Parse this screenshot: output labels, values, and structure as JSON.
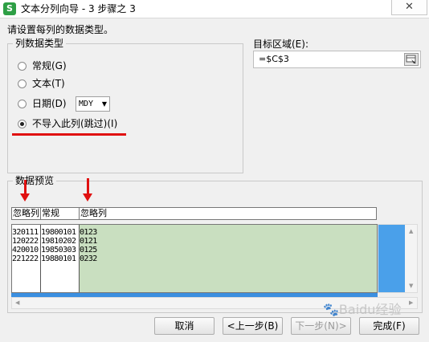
{
  "titlebar": {
    "app_icon": "S",
    "title": "文本分列向导 - 3 步骤之 3",
    "close": "✕"
  },
  "instruction": "请设置每列的数据类型。",
  "column_type_group": {
    "legend": "列数据类型",
    "options": [
      {
        "label": "常规(G)",
        "checked": false
      },
      {
        "label": "文本(T)",
        "checked": false
      },
      {
        "label": "日期(D)",
        "checked": false
      },
      {
        "label": "不导入此列(跳过)(I)",
        "checked": true
      }
    ],
    "date_format": "MDY"
  },
  "target": {
    "label": "目标区域(E):",
    "value": "=$C$3"
  },
  "preview": {
    "legend": "数据预览",
    "headers": [
      "忽略列",
      "常规",
      "忽略列"
    ],
    "columns": [
      [
        "320111",
        "120222",
        "420010",
        "221222"
      ],
      [
        "19800101",
        "19810202",
        "19850303",
        "19880101"
      ],
      [
        "0123",
        "0121",
        "0125",
        "0232"
      ]
    ]
  },
  "buttons": {
    "cancel": "取消",
    "back": "<上一步(B)",
    "next": "下一步(N)>",
    "finish": "完成(F)"
  },
  "watermark": "Baidu经验",
  "colors": {
    "annotation_red": "#e01010",
    "preview_green": "#c9dfc0",
    "scroll_blue": "#4aa0ea"
  }
}
